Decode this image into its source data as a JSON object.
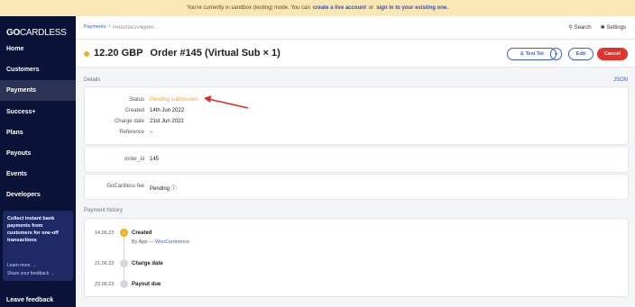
{
  "banner": {
    "text1": "You're currently in sandbox (testing) mode. You can",
    "link1": "create a live account",
    "text2": "or",
    "link2": "sign in to your existing one."
  },
  "sidebar": {
    "logo_bold": "GO",
    "logo_light": "CARDLESS",
    "items": [
      {
        "label": "Home"
      },
      {
        "label": "Customers"
      },
      {
        "label": "Payments"
      },
      {
        "label": "Success+"
      },
      {
        "label": "Plans"
      },
      {
        "label": "Payouts"
      },
      {
        "label": "Events"
      },
      {
        "label": "Developers"
      }
    ],
    "promo": {
      "title": "Collect instant bank payments from customers for one-off transactions",
      "learn_more": "Learn more →",
      "share": "Share your feedback →"
    },
    "feedback": "Leave feedback"
  },
  "breadcrumb": {
    "root": "Payments",
    "sep": "/",
    "id": "PM005DKSVMQRMY"
  },
  "topbar": {
    "search": "⚲ Search",
    "settings": "✱ Settings"
  },
  "header": {
    "amount": "12.20 GBP",
    "title": "Order #145 (Virtual Sub × 1)",
    "customer_button": "♙ Test Tet",
    "dropdown": "▾",
    "edit": "Edit",
    "cancel": "Cancel",
    "status_color": "#f2b11d"
  },
  "details": {
    "section": "Details",
    "json": "JSON",
    "status_label": "Status",
    "status_value": "Pending submission",
    "created_label": "Created",
    "created_value": "14th Jun 2022",
    "charge_label": "Charge date",
    "charge_value": "21st Jun 2022",
    "reference_label": "Reference",
    "reference_value": "–",
    "order_label": "order_id",
    "order_value": "145",
    "fee_label": "GoCardless fee",
    "fee_value": "Pending ⓘ"
  },
  "history": {
    "section": "Payment history",
    "events": [
      {
        "date": "14.06.22",
        "title": "Created",
        "sub_prefix": "By App —",
        "sub_link": "WooCommerce"
      },
      {
        "date": "21.06.22",
        "title": "Charge date"
      },
      {
        "date": "23.06.22",
        "title": "Payout due"
      }
    ]
  }
}
